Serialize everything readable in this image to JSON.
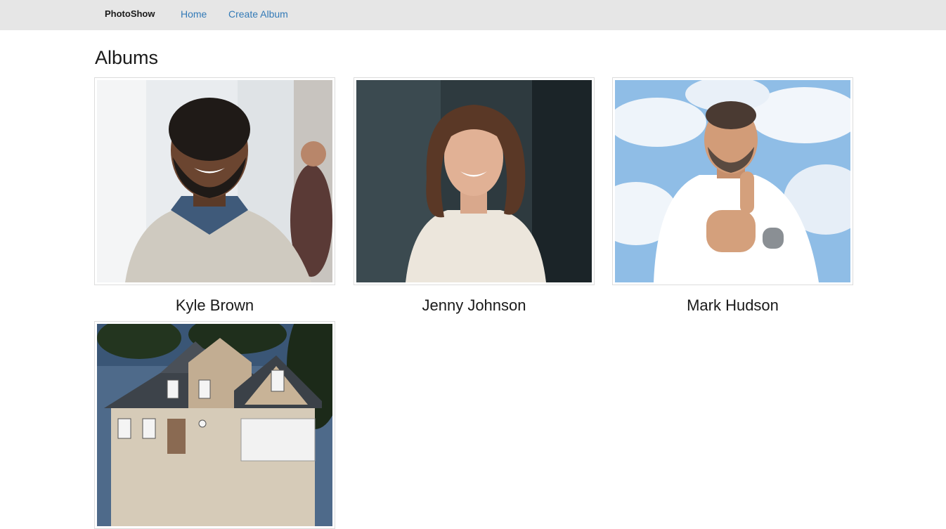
{
  "navbar": {
    "brand": "PhotoShow",
    "links": [
      {
        "label": "Home"
      },
      {
        "label": "Create Album"
      }
    ]
  },
  "page": {
    "title": "Albums"
  },
  "albums": [
    {
      "name": "Kyle Brown"
    },
    {
      "name": "Jenny Johnson"
    },
    {
      "name": "Mark Hudson"
    },
    {
      "name": ""
    }
  ],
  "colors": {
    "navbar_bg": "#e6e6e6",
    "link": "#337ab7",
    "thumb_border": "#dcdcdc"
  }
}
